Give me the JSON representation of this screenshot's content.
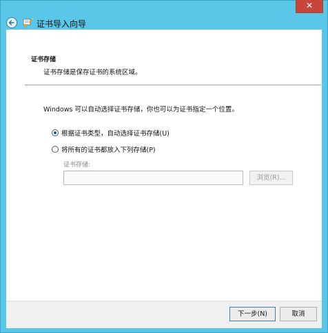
{
  "window": {
    "title": "证书导入向导",
    "close_glyph": "✕"
  },
  "header": {
    "title": "证书存储",
    "subtitle": "证书存储是保存证书的系统区域。"
  },
  "main": {
    "description": "Windows 可以自动选择证书存储，你也可以为证书指定一个位置。",
    "options": [
      {
        "label": "根据证书类型，自动选择证书存储(U)",
        "selected": true
      },
      {
        "label": "将所有的证书都放入下列存储(P)",
        "selected": false
      }
    ],
    "store_label": "证书存储:",
    "store_value": "",
    "browse_label": "浏览(R)..."
  },
  "footer": {
    "next_label": "下一步(N)",
    "cancel_label": "取消"
  },
  "colors": {
    "title_bar": "#5bc7e8",
    "close_button": "#c7463c",
    "radio_selected": "#1d4fa0"
  },
  "icons": [
    "back-arrow-icon",
    "certificate-wizard-icon",
    "close-icon"
  ]
}
